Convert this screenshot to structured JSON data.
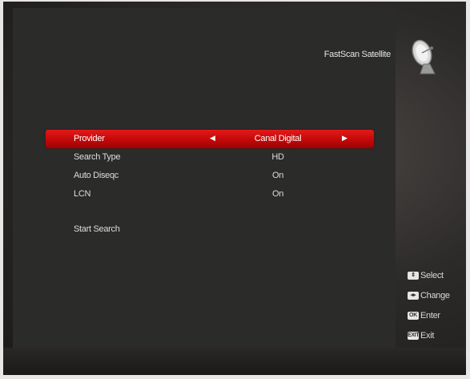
{
  "header": {
    "title": "FastScan Satellite",
    "icon": "satellite-dish-icon"
  },
  "menu": {
    "items": [
      {
        "label": "Provider",
        "value": "Canal Digital",
        "selected": true
      },
      {
        "label": "Search Type",
        "value": "HD"
      },
      {
        "label": "Auto Diseqc",
        "value": "On"
      },
      {
        "label": "LCN",
        "value": "On"
      },
      {
        "label": "Start Search",
        "value": ""
      }
    ],
    "left_arrow": "◀",
    "right_arrow": "▶"
  },
  "hints": [
    {
      "key": "⇕",
      "label": "Select"
    },
    {
      "key": "◂▸",
      "label": "Change"
    },
    {
      "key": "OK",
      "label": "Enter"
    },
    {
      "key": "EXIT",
      "label": "Exit"
    }
  ],
  "colors": {
    "selected_row": "#c30808",
    "panel": "#2b2b2a",
    "text": "#dcdcdc"
  }
}
